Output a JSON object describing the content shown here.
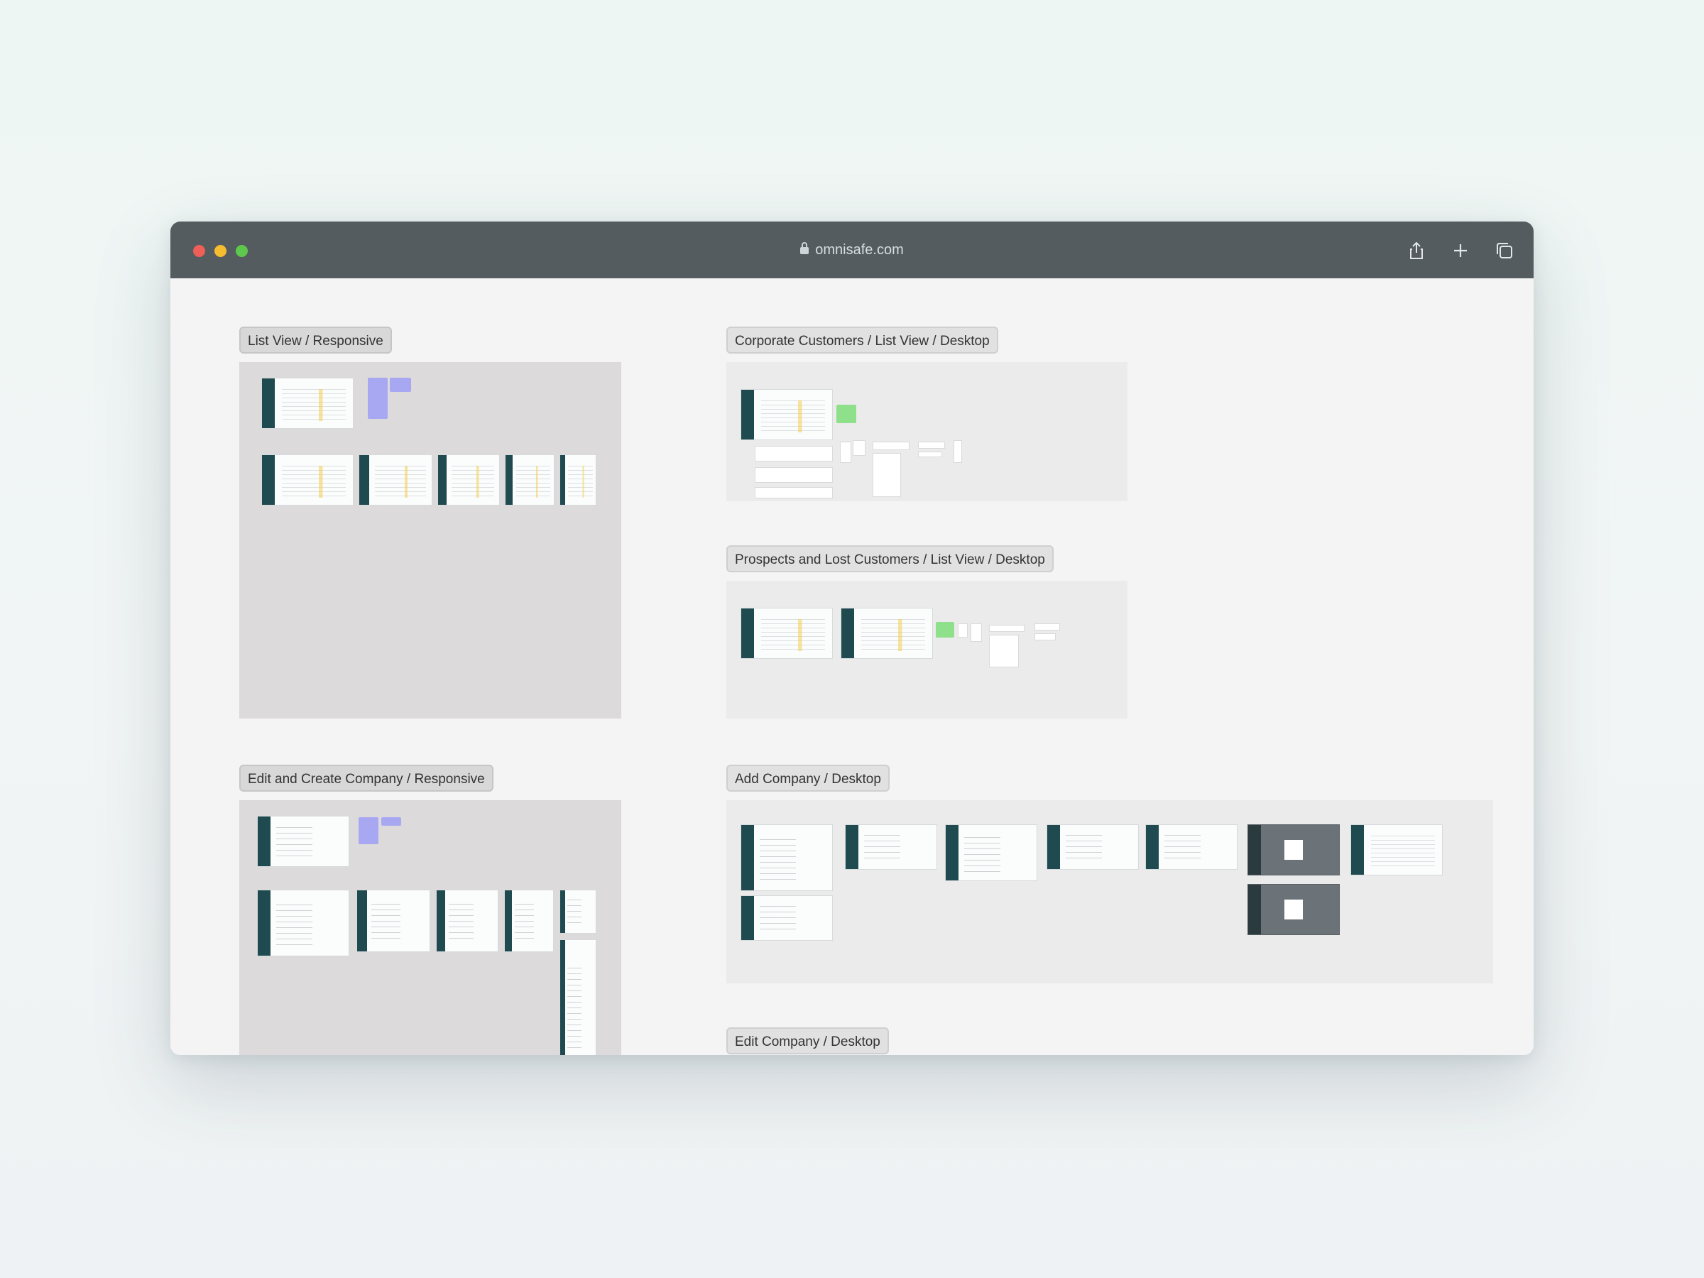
{
  "browser": {
    "url": "omnisafe.com",
    "toolbar_icons": [
      "share-icon",
      "new-tab-icon",
      "tab-overview-icon"
    ]
  },
  "sections": [
    {
      "id": "list-view-responsive",
      "label": "List View / Responsive"
    },
    {
      "id": "corporate-customers",
      "label": "Corporate Customers / List View / Desktop"
    },
    {
      "id": "prospects-lost",
      "label": "Prospects and Lost Customers / List View / Desktop"
    },
    {
      "id": "edit-create-company",
      "label": "Edit and Create Company / Responsive"
    },
    {
      "id": "add-company",
      "label": "Add Company / Desktop"
    },
    {
      "id": "edit-company",
      "label": "Edit Company / Desktop"
    }
  ]
}
